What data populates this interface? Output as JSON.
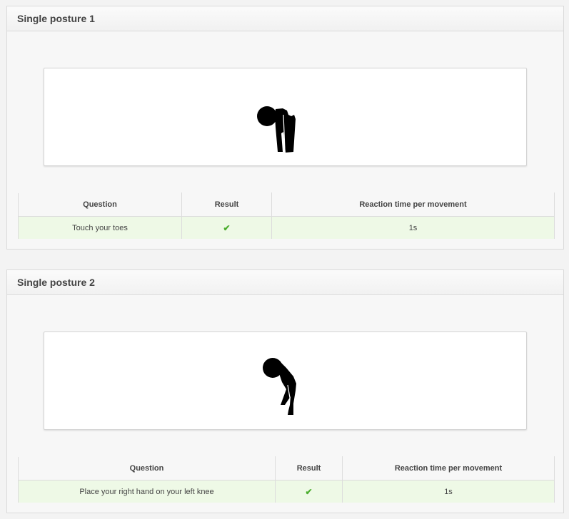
{
  "colors": {
    "page_background": "#f3f3f3",
    "panel_background": "#f7f7f7",
    "success_row": "#eef9e6",
    "check_mark": "#4cae2f"
  },
  "postures": [
    {
      "title": "Single posture 1",
      "figure_icon": "figure-bending-touching-toes-icon",
      "table": {
        "headers": [
          "Question",
          "Result",
          "Reaction time per movement"
        ],
        "row": {
          "question": "Touch your toes",
          "result_icon": "check-icon",
          "result_glyph": "✔",
          "reaction_time": "1s"
        }
      }
    },
    {
      "title": "Single posture 2",
      "figure_icon": "figure-bending-hand-on-knee-icon",
      "table": {
        "headers": [
          "Question",
          "Result",
          "Reaction time per movement"
        ],
        "row": {
          "question": "Place your right hand on your left knee",
          "result_icon": "check-icon",
          "result_glyph": "✔",
          "reaction_time": "1s"
        }
      }
    }
  ]
}
